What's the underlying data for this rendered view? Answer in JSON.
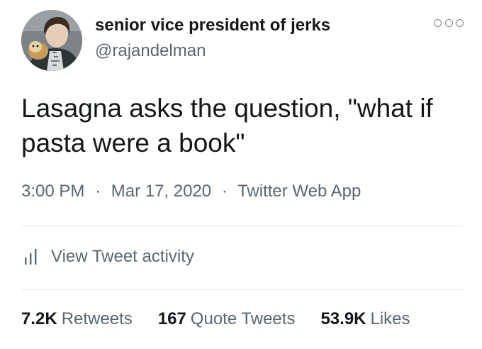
{
  "user": {
    "display_name": "senior vice president of jerks",
    "handle": "@rajandelman",
    "avatar_icon": "profile-photo"
  },
  "more_icon": "more-options-icon",
  "tweet": {
    "text": "Lasagna asks the question, \"what if pasta were a book\""
  },
  "meta": {
    "time": "3:00 PM",
    "separator": "·",
    "date": "Mar 17, 2020",
    "source": "Twitter Web App"
  },
  "activity": {
    "icon": "bar-chart-icon",
    "label": "View Tweet activity"
  },
  "stats": {
    "retweets_count": "7.2K",
    "retweets_label": "Retweets",
    "quotes_count": "167",
    "quotes_label": "Quote Tweets",
    "likes_count": "53.9K",
    "likes_label": "Likes"
  },
  "colors": {
    "text_primary": "#14171a",
    "text_secondary": "#5b6670",
    "divider": "#e3e7ea",
    "background": "#ffffff"
  }
}
